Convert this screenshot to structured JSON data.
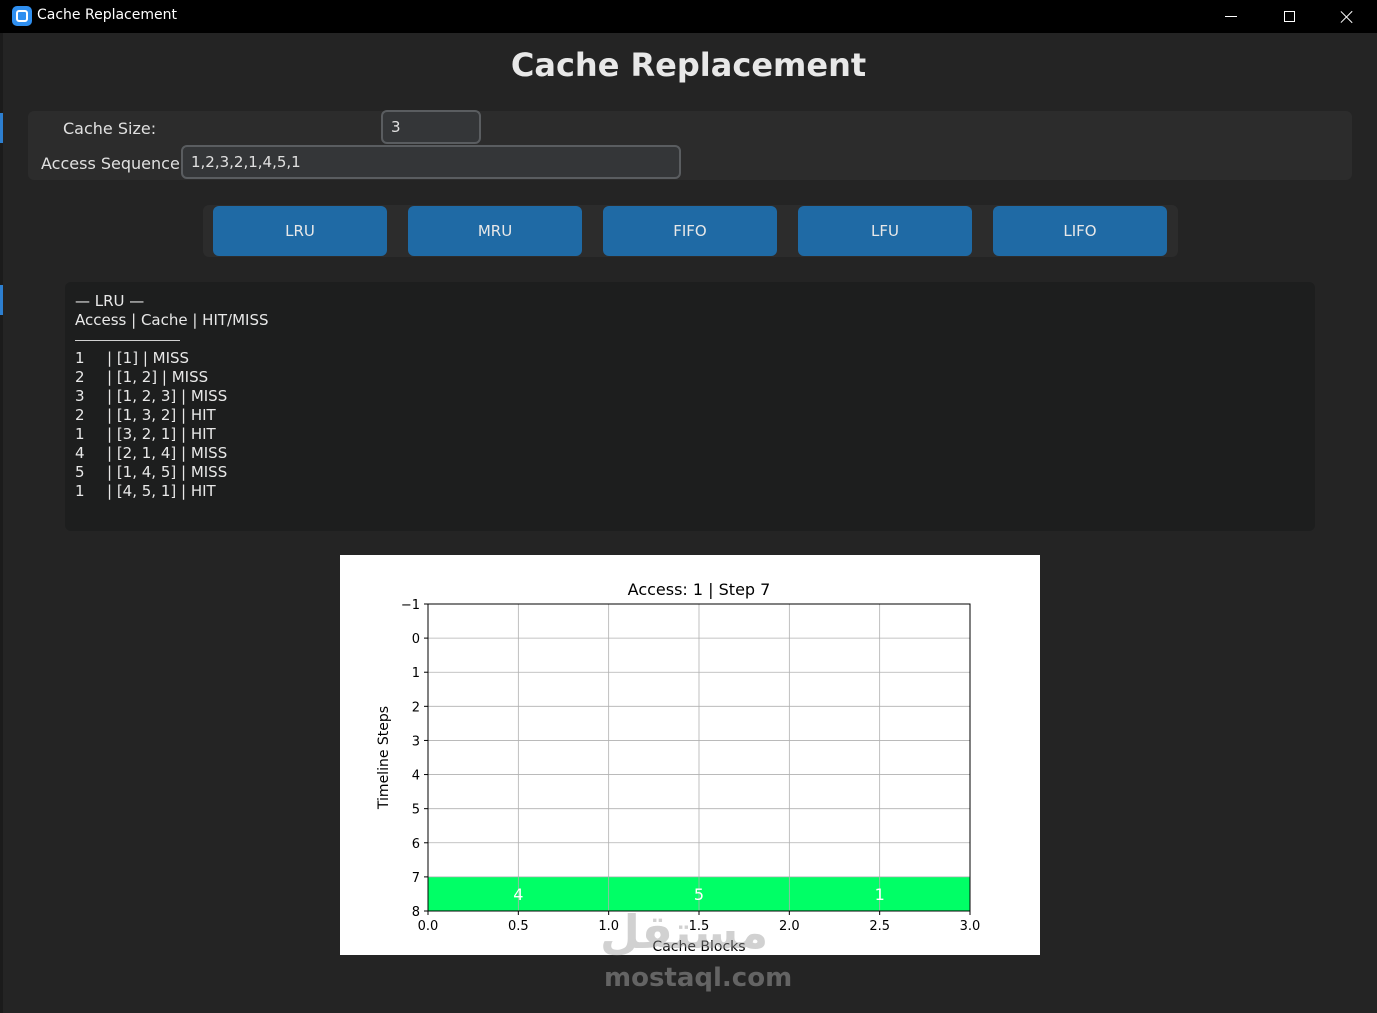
{
  "window": {
    "title": "Cache Replacement"
  },
  "page": {
    "title": "Cache Replacement"
  },
  "inputs": {
    "cache_size_label": "Cache Size:",
    "cache_size_value": "3",
    "sequence_label": "Access Sequence:",
    "sequence_value": "1,2,3,2,1,4,5,1"
  },
  "buttons": [
    "LRU",
    "MRU",
    "FIFO",
    "LFU",
    "LIFO"
  ],
  "output": {
    "heading": "— LRU —",
    "columns": "Access | Cache | HIT/MISS",
    "rows": [
      {
        "access": "1",
        "rest": "| [1] | MISS"
      },
      {
        "access": "2",
        "rest": "| [1, 2] | MISS"
      },
      {
        "access": "3",
        "rest": "| [1, 2, 3] | MISS"
      },
      {
        "access": "2",
        "rest": "| [1, 3, 2] | HIT"
      },
      {
        "access": "1",
        "rest": "| [3, 2, 1] | HIT"
      },
      {
        "access": "4",
        "rest": "| [2, 1, 4] | MISS"
      },
      {
        "access": "5",
        "rest": "| [1, 4, 5] | MISS"
      },
      {
        "access": "1",
        "rest": "| [4, 5, 1] | HIT"
      }
    ]
  },
  "chart_data": {
    "type": "heatmap",
    "title": "Access: 1 | Step 7",
    "xlabel": "Cache Blocks",
    "ylabel": "Timeline Steps",
    "xlim": [
      0.0,
      3.0
    ],
    "ylim": [
      8,
      -1
    ],
    "xticks": [
      "0.0",
      "0.5",
      "1.0",
      "1.5",
      "2.0",
      "2.5",
      "3.0"
    ],
    "yticks": [
      "−1",
      "0",
      "1",
      "2",
      "3",
      "4",
      "5",
      "6",
      "7",
      "8"
    ],
    "grid": true,
    "row_step": 7,
    "cells": [
      {
        "x0": 0,
        "x1": 1,
        "value": "4"
      },
      {
        "x0": 1,
        "x1": 2,
        "value": "5"
      },
      {
        "x0": 2,
        "x1": 3,
        "value": "1"
      }
    ],
    "fill_color": "#00ff66"
  },
  "watermark": {
    "text": "mostaql.com",
    "arabic": "مستقل"
  }
}
